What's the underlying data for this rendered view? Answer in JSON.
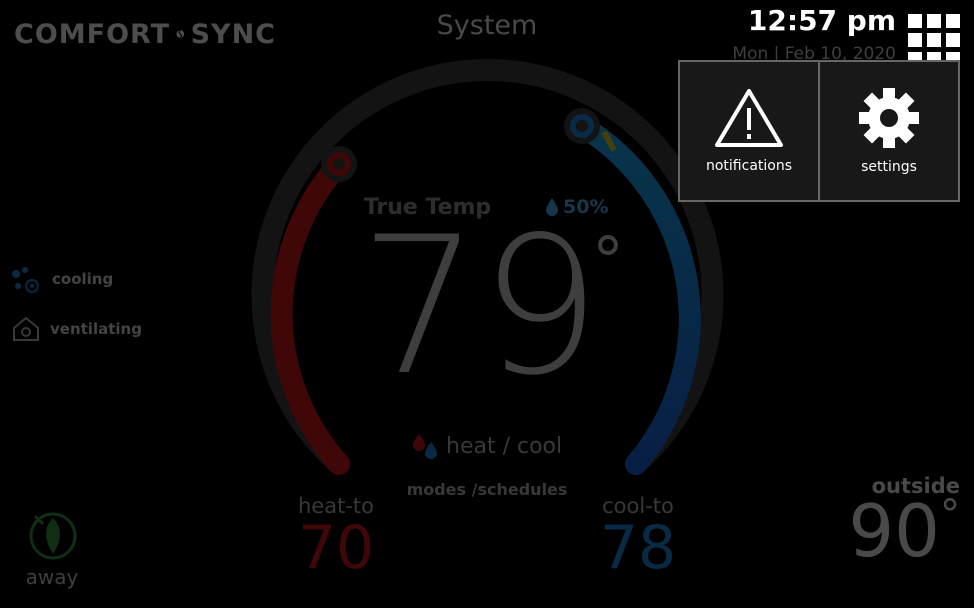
{
  "header": {
    "logo_text_left": "COMFORT",
    "logo_text_right": "SYNC",
    "title": "System",
    "time": "12:57 pm",
    "date": "Mon | Feb 10, 2020"
  },
  "dial": {
    "label": "True Temp",
    "humidity": "50%",
    "temperature": "79",
    "degree_symbol": "°",
    "mode": "heat / cool",
    "modes_link": "modes /schedules"
  },
  "heat_to": {
    "label": "heat-to",
    "value": "70",
    "color": "#c0161b"
  },
  "cool_to": {
    "label": "cool-to",
    "value": "78",
    "color": "#1a7fd1"
  },
  "status": [
    {
      "label": "cooling",
      "icon": "cooling-icon"
    },
    {
      "label": "ventilating",
      "icon": "house-fan-icon"
    }
  ],
  "outside": {
    "label": "outside",
    "value": "90",
    "degree_symbol": "°"
  },
  "away": {
    "label": "away",
    "icon": "leaf-icon"
  },
  "popup": {
    "notifications_label": "notifications",
    "settings_label": "settings"
  },
  "colors": {
    "heat": "#c0161b",
    "cool": "#1a7fd1",
    "popup_bg": "#181818"
  }
}
